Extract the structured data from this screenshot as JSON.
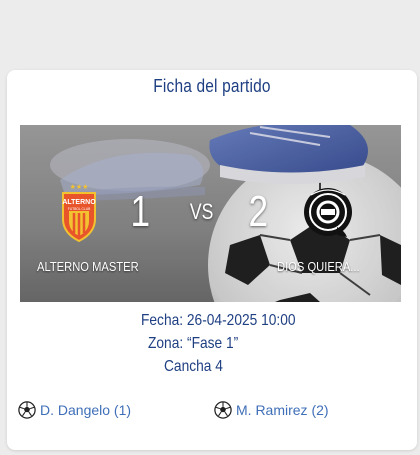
{
  "match": {
    "title": "Ficha del partido",
    "home": {
      "name": "ALTERNO MASTER",
      "score": "1",
      "logo": "alterno-crest-icon"
    },
    "away": {
      "name": "DIOS QUIERA...",
      "score": "2",
      "logo": "dios-quiera-crest-icon"
    },
    "vs_label": "VS",
    "logo_text": "ALTERNO",
    "logo_subtext": "FUTBOL CLUB",
    "date_line": "Fecha: 26-04-2025 10:00",
    "zone_line": "Zona: “Fase 1”",
    "court_line": "Cancha 4",
    "scorers": [
      {
        "text": "D. Dangelo (1)",
        "icon": "soccer-ball-icon"
      },
      {
        "text": "M. Ramirez (2)",
        "icon": "soccer-ball-icon"
      }
    ]
  },
  "colors": {
    "title": "#1e3f82",
    "scorer": "#3f6fb8",
    "card": "#ffffff",
    "page": "#ececec"
  }
}
